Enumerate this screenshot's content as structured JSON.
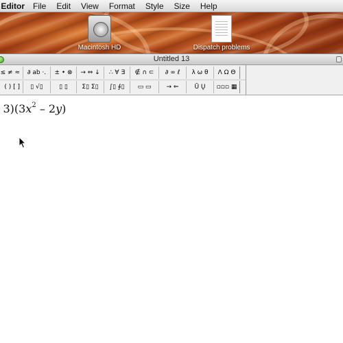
{
  "menubar": {
    "app_name": "ion Editor",
    "items": [
      "File",
      "Edit",
      "View",
      "Format",
      "Style",
      "Size",
      "Help"
    ]
  },
  "desktop": {
    "icons": [
      {
        "label": "Macintosh HD",
        "icon": "hard-drive-icon"
      },
      {
        "label": "Dispatch problems",
        "icon": "document-icon"
      }
    ]
  },
  "window": {
    "title": "Untitled 13"
  },
  "palettes": {
    "row1": [
      "≤ ≠ ≈",
      "∂ ab ·.",
      "± • ⊗",
      "→ ⇔ ↓",
      "∴ ∀ ∃",
      "∉ ∩ ⊂",
      "∂ ∞ ℓ",
      "λ ω θ",
      "Λ Ω Θ"
    ],
    "row2": [
      "( ) [ ]",
      "▯ √▯",
      "▯ ▯",
      "Σ▯ Σ▯",
      "∫▯ ∮▯",
      "▭ ▭",
      "→ ⇐",
      "Ū Ų",
      "▫▫▫ ▦"
    ]
  },
  "equation": {
    "prefix": "- 3)(3",
    "var_x": "x",
    "exponent": "2",
    "middle": " – 2",
    "var_y": "y",
    "suffix": ")"
  },
  "colors": {
    "wallpaper": "#b04a1c",
    "zoom_button": "#3fa020"
  }
}
